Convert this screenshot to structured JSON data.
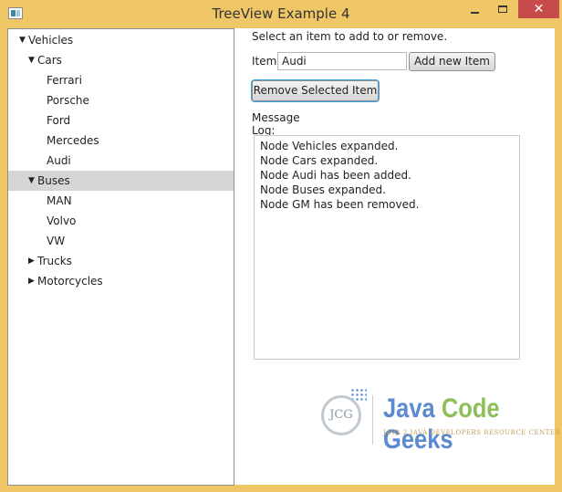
{
  "window": {
    "title": "TreeView Example 4",
    "controls": {
      "minimize": "minimize",
      "maximize": "maximize",
      "close": "✕"
    }
  },
  "tree": {
    "items": [
      {
        "label": "Vehicles",
        "level": 0,
        "state": "expanded",
        "selected": false
      },
      {
        "label": "Cars",
        "level": 1,
        "state": "expanded",
        "selected": false
      },
      {
        "label": "Ferrari",
        "level": 2,
        "state": "leaf",
        "selected": false
      },
      {
        "label": "Porsche",
        "level": 2,
        "state": "leaf",
        "selected": false
      },
      {
        "label": "Ford",
        "level": 2,
        "state": "leaf",
        "selected": false
      },
      {
        "label": "Mercedes",
        "level": 2,
        "state": "leaf",
        "selected": false
      },
      {
        "label": "Audi",
        "level": 2,
        "state": "leaf",
        "selected": false
      },
      {
        "label": "Buses",
        "level": 1,
        "state": "expanded",
        "selected": true
      },
      {
        "label": "MAN",
        "level": 2,
        "state": "leaf",
        "selected": false
      },
      {
        "label": "Volvo",
        "level": 2,
        "state": "leaf",
        "selected": false
      },
      {
        "label": "VW",
        "level": 2,
        "state": "leaf",
        "selected": false
      },
      {
        "label": "Trucks",
        "level": 1,
        "state": "collapsed",
        "selected": false
      },
      {
        "label": "Motorcycles",
        "level": 1,
        "state": "collapsed",
        "selected": false
      }
    ]
  },
  "form": {
    "instruction": "Select an item to add to or remove.",
    "item_label": "Item:",
    "item_value": "Audi",
    "add_button": "Add new Item",
    "remove_button": "Remove Selected Item",
    "log_label": "Message Log:"
  },
  "log": {
    "lines": [
      "Node Vehicles expanded.",
      "Node Cars expanded.",
      "Node Audi has been added.",
      "Node Buses expanded.",
      "Node GM has been removed."
    ]
  },
  "watermark": {
    "badge": "JCG",
    "word1": "Java",
    "word2": "Code",
    "word3": "Geeks",
    "tagline": "JAVA 2 JAVA DEVELOPERS RESOURCE CENTER"
  },
  "colors": {
    "frame": "#f0c766",
    "close": "#c74b4b",
    "selection": "#d6d6d6",
    "focus": "#3aa0e0"
  }
}
